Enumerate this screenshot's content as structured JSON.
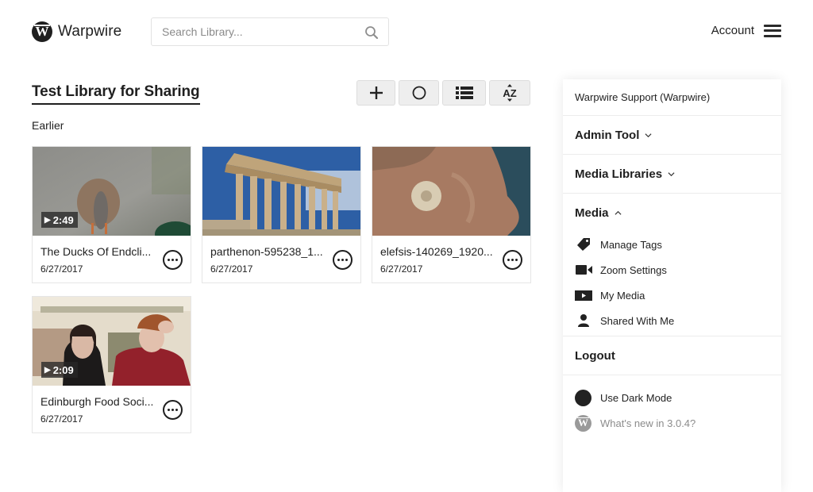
{
  "header": {
    "brand": "Warpwire",
    "brand_mark": "W",
    "search_placeholder": "Search Library...",
    "search_value": "",
    "account_label": "Account"
  },
  "library": {
    "title": "Test Library for Sharing",
    "section_label": "Earlier",
    "toolbar": [
      {
        "icon": "plus-icon",
        "action": "Add"
      },
      {
        "icon": "circle-icon",
        "action": "Select"
      },
      {
        "icon": "list-view-icon",
        "action": "List view"
      },
      {
        "icon": "sort-az-icon",
        "action": "Sort",
        "glyph": "AZ"
      }
    ],
    "items": [
      {
        "title": "The Ducks Of Endcli...",
        "date": "6/27/2017",
        "duration": "2:49",
        "thumb": "ducks"
      },
      {
        "title": "parthenon-595238_1...",
        "date": "6/27/2017",
        "duration": null,
        "thumb": "parthenon"
      },
      {
        "title": "elefsis-140269_1920...",
        "date": "6/27/2017",
        "duration": null,
        "thumb": "statue"
      },
      {
        "title": "Edinburgh Food Soci...",
        "date": "6/27/2017",
        "duration": "2:09",
        "thumb": "food"
      }
    ]
  },
  "menu": {
    "user": "Warpwire Support (Warpwire)",
    "admin_tool": "Admin Tool",
    "media_libraries": "Media Libraries",
    "media": "Media",
    "media_items": [
      {
        "label": "Manage Tags",
        "icon": "tag-icon"
      },
      {
        "label": "Zoom Settings",
        "icon": "video-camera-icon"
      },
      {
        "label": "My Media",
        "icon": "play-box-icon"
      },
      {
        "label": "Shared With Me",
        "icon": "person-icon"
      }
    ],
    "logout": "Logout",
    "dark_mode": "Use Dark Mode",
    "whats_new": "What's new in 3.0.4?"
  },
  "colors": {
    "text": "#222222",
    "button_bg": "#eeeeee",
    "muted": "#8c8c8c"
  }
}
